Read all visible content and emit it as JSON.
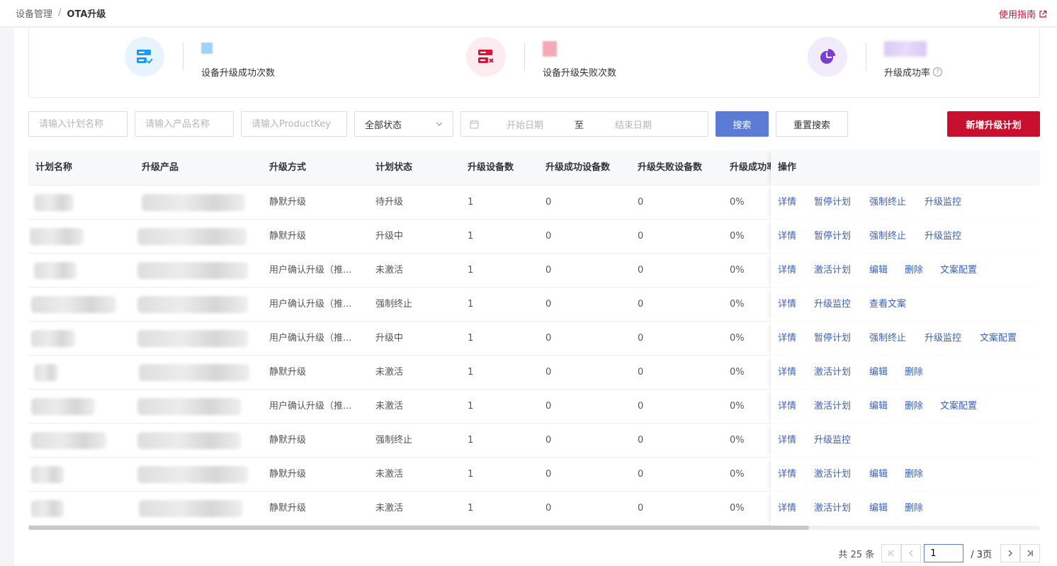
{
  "breadcrumb": {
    "root": "设备管理",
    "separator": "/",
    "current": "OTA升级"
  },
  "header": {
    "guide_label": "使用指南"
  },
  "stats": [
    {
      "label": "设备升级成功次数",
      "icon": "server-check-icon",
      "color": "#1e9bf0",
      "bg": "#e8f4fd"
    },
    {
      "label": "设备升级失败次数",
      "icon": "server-x-icon",
      "color": "#d6163b",
      "bg": "#fdecef"
    },
    {
      "label": "升级成功率",
      "icon": "pie-chart-icon",
      "color": "#7b3fd0",
      "bg": "#f1ebfb"
    }
  ],
  "filters": {
    "plan_name_placeholder": "请输入计划名称",
    "product_name_placeholder": "请输入产品名称",
    "product_key_placeholder": "请输入ProductKey",
    "status_selected": "全部状态",
    "start_date_placeholder": "开始日期",
    "date_separator": "至",
    "end_date_placeholder": "结束日期",
    "search_label": "搜索",
    "reset_label": "重置搜索",
    "new_plan_label": "新增升级计划"
  },
  "table": {
    "columns": [
      "计划名称",
      "升级产品",
      "升级方式",
      "计划状态",
      "升级设备数",
      "升级成功设备数",
      "升级失败设备数",
      "升级成功率",
      "操作"
    ],
    "rows": [
      {
        "method": "静默升级",
        "status": "待升级",
        "devices": "1",
        "success": "0",
        "failed": "0",
        "rate": "0%",
        "actions": [
          "详情",
          "暂停计划",
          "强制终止",
          "升级监控"
        ]
      },
      {
        "method": "静默升级",
        "status": "升级中",
        "devices": "1",
        "success": "0",
        "failed": "0",
        "rate": "0%",
        "actions": [
          "详情",
          "暂停计划",
          "强制终止",
          "升级监控"
        ]
      },
      {
        "method": "用户确认升级（推...",
        "status": "未激活",
        "devices": "1",
        "success": "0",
        "failed": "0",
        "rate": "0%",
        "actions": [
          "详情",
          "激活计划",
          "编辑",
          "删除",
          "文案配置"
        ]
      },
      {
        "method": "用户确认升级（推...",
        "status": "强制终止",
        "devices": "1",
        "success": "0",
        "failed": "0",
        "rate": "0%",
        "actions": [
          "详情",
          "升级监控",
          "查看文案"
        ]
      },
      {
        "method": "用户确认升级（推...",
        "status": "升级中",
        "devices": "1",
        "success": "0",
        "failed": "0",
        "rate": "0%",
        "actions": [
          "详情",
          "暂停计划",
          "强制终止",
          "升级监控",
          "文案配置"
        ]
      },
      {
        "method": "静默升级",
        "status": "未激活",
        "devices": "1",
        "success": "0",
        "failed": "0",
        "rate": "0%",
        "actions": [
          "详情",
          "激活计划",
          "编辑",
          "删除"
        ]
      },
      {
        "method": "用户确认升级（推...",
        "status": "未激活",
        "devices": "1",
        "success": "0",
        "failed": "0",
        "rate": "0%",
        "actions": [
          "详情",
          "激活计划",
          "编辑",
          "删除",
          "文案配置"
        ]
      },
      {
        "method": "静默升级",
        "status": "强制终止",
        "devices": "1",
        "success": "0",
        "failed": "0",
        "rate": "0%",
        "actions": [
          "详情",
          "升级监控"
        ]
      },
      {
        "method": "静默升级",
        "status": "未激活",
        "devices": "1",
        "success": "0",
        "failed": "0",
        "rate": "0%",
        "actions": [
          "详情",
          "激活计划",
          "编辑",
          "删除"
        ]
      },
      {
        "method": "静默升级",
        "status": "未激活",
        "devices": "1",
        "success": "0",
        "failed": "0",
        "rate": "0%",
        "actions": [
          "详情",
          "激活计划",
          "编辑",
          "删除"
        ]
      }
    ]
  },
  "pagination": {
    "total_text": "共 25 条",
    "current_page": "1",
    "total_pages_text": "/ 3页"
  }
}
